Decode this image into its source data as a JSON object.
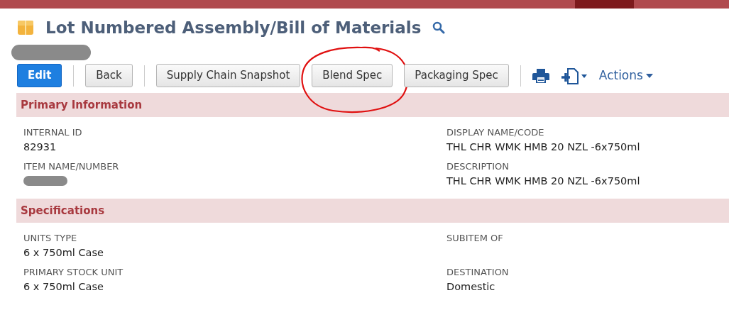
{
  "title": "Lot Numbered Assembly/Bill of Materials",
  "subtitle_redacted": true,
  "buttons": [
    {
      "label": "Edit",
      "primary": true,
      "circled": false
    },
    {
      "label": "Back",
      "primary": false,
      "circled": false
    },
    {
      "label": "Supply Chain Snapshot",
      "primary": false,
      "circled": false
    },
    {
      "label": "Blend Spec",
      "primary": false,
      "circled": true
    },
    {
      "label": "Packaging Spec",
      "primary": false,
      "circled": false
    }
  ],
  "actions_label": "Actions",
  "sections": [
    {
      "title": "Primary Information",
      "fields": [
        {
          "label": "INTERNAL ID",
          "value": "82931"
        },
        {
          "label": "DISPLAY NAME/CODE",
          "value": "THL CHR WMK HMB 20 NZL -6x750ml"
        },
        {
          "label": "ITEM NAME/NUMBER",
          "redacted": true
        },
        {
          "label": "DESCRIPTION",
          "value": "THL CHR WMK HMB 20 NZL -6x750ml"
        }
      ]
    },
    {
      "title": "Specifications",
      "fields": [
        {
          "label": "UNITS TYPE",
          "value": "6 x 750ml Case"
        },
        {
          "label": "SUBITEM OF"
        },
        {
          "label": "PRIMARY STOCK UNIT",
          "value": "6 x 750ml Case"
        },
        {
          "label": "DESTINATION",
          "value": "Domestic"
        }
      ]
    }
  ]
}
